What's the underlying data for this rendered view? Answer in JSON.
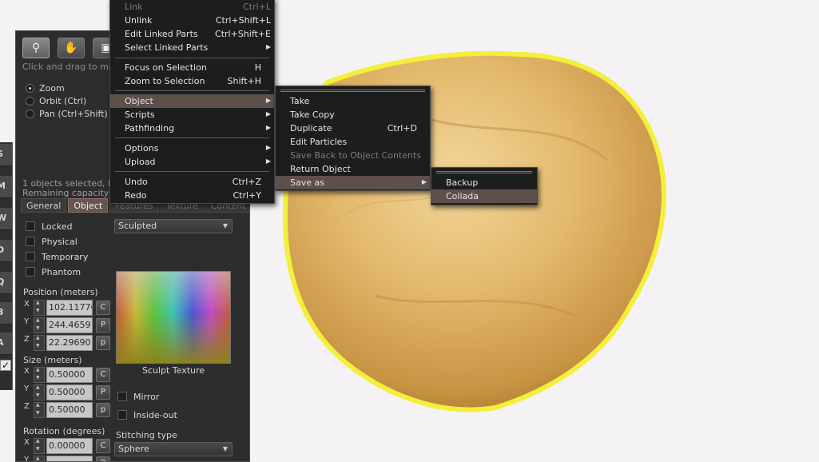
{
  "build_floater": {
    "tools": [
      "magnifier",
      "rotate-hand",
      "move-object"
    ],
    "hint": "Click and drag to mo",
    "camera_modes": [
      {
        "label": "Zoom",
        "selected": true
      },
      {
        "label": "Orbit (Ctrl)",
        "selected": false
      },
      {
        "label": "Pan (Ctrl+Shift)",
        "selected": false
      }
    ],
    "status": {
      "selected": "1 objects selected, l",
      "capacity": "Remaining capacity"
    },
    "tabs": [
      "General",
      "Object",
      "Features",
      "Texture",
      "Content"
    ],
    "active_tab": "Object",
    "checkboxes": [
      "Locked",
      "Physical",
      "Temporary",
      "Phantom"
    ],
    "position": {
      "label": "Position (meters)",
      "x": "102.11776",
      "y": "244.4659",
      "z": "22.29690",
      "buttons": [
        "C",
        "P",
        "p"
      ]
    },
    "size": {
      "label": "Size (meters)",
      "x": "0.50000",
      "y": "0.50000",
      "z": "0.50000",
      "buttons": [
        "C",
        "P",
        "p"
      ]
    },
    "rotation": {
      "label": "Rotation (degrees)",
      "x": "0.00000",
      "button_c": "C",
      "button_p": "P"
    },
    "axes": [
      "X",
      "Y",
      "Z"
    ],
    "shape_type": "Sculpted",
    "sculpt_texture_label": "Sculpt Texture",
    "mirror_label": "Mirror",
    "inside_out_label": "Inside-out",
    "stitching": {
      "label": "Stitching type",
      "value": "Sphere"
    }
  },
  "context_menu": {
    "items": [
      {
        "label": "Link",
        "shortcut": "Ctrl+L",
        "disabled": true
      },
      {
        "label": "Unlink",
        "shortcut": "Ctrl+Shift+L"
      },
      {
        "label": "Edit Linked Parts",
        "shortcut": "Ctrl+Shift+E"
      },
      {
        "label": "Select Linked Parts",
        "submenu": true
      },
      {
        "label": "Focus on Selection",
        "shortcut": "H"
      },
      {
        "label": "Zoom to Selection",
        "shortcut": "Shift+H"
      },
      {
        "label": "Object",
        "submenu": true,
        "highlighted": true
      },
      {
        "label": "Scripts",
        "submenu": true
      },
      {
        "label": "Pathfinding",
        "submenu": true
      },
      {
        "label": "Options",
        "submenu": true
      },
      {
        "label": "Upload",
        "submenu": true
      },
      {
        "label": "Undo",
        "shortcut": "Ctrl+Z"
      },
      {
        "label": "Redo",
        "shortcut": "Ctrl+Y"
      }
    ]
  },
  "object_menu": {
    "items": [
      {
        "label": "Take"
      },
      {
        "label": "Take Copy"
      },
      {
        "label": "Duplicate",
        "shortcut": "Ctrl+D"
      },
      {
        "label": "Edit Particles"
      },
      {
        "label": "Save Back to Object Contents",
        "disabled": true
      },
      {
        "label": "Return Object"
      },
      {
        "label": "Save as",
        "submenu": true,
        "highlighted": true
      }
    ]
  },
  "save_as_menu": {
    "items": [
      {
        "label": "Backup"
      },
      {
        "label": "Collada",
        "highlighted": true
      }
    ]
  },
  "edge_toolbar_glyphs": [
    "S",
    "M",
    "W",
    "D",
    "Q",
    "B",
    "A"
  ],
  "colors": {
    "menu_bg": "#1d1d1d",
    "menu_highlight": "#5f4f4b",
    "active_tab": "#6a5450",
    "selection_outline": "#f4ef3a",
    "object_fill": "#e2b86a"
  }
}
